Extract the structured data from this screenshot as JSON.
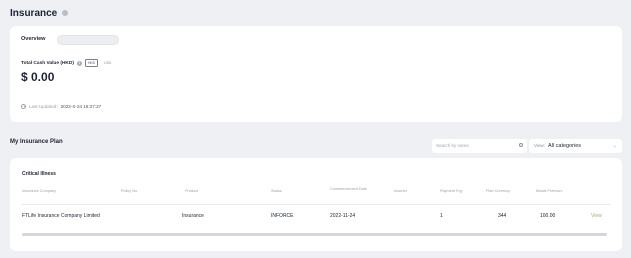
{
  "page": {
    "title": "Insurance"
  },
  "overview": {
    "title": "Overview",
    "total_cash_label": "Total Cash Value (HKD)",
    "currencies": [
      {
        "label": "HKD",
        "active": true
      },
      {
        "label": "USD",
        "active": false
      }
    ],
    "total_cash_value": "$ 0.00",
    "last_updated_label": "Last Updated:",
    "last_updated_value": "2022-X-24 18:27:27"
  },
  "plans": {
    "title": "My Insurance Plan",
    "search_placeholder": "Search by name",
    "view_label": "View:",
    "view_value": "All categories",
    "section": "Critical Illness",
    "columns": [
      "Insurance Company",
      "Policy No.",
      "Product",
      "Status",
      "Commencement Date",
      "Insured",
      "Payment Fqy",
      "Plan Currency",
      "Modal Premium"
    ],
    "rows": [
      {
        "company": "FTLife Insurance Company Limited",
        "policy_no": "",
        "product": "Insurance",
        "status": "INFORCE",
        "commencement_date": "2022-11-24",
        "insured": "",
        "payment_freq": "1",
        "plan_currency": "344",
        "modal_premium": "100.00",
        "action": "View"
      }
    ]
  },
  "colors": {
    "background": "#eef0f3",
    "card": "#ffffff",
    "text": "#1c2433",
    "muted": "#9aa1ab",
    "link": "#9db27a"
  }
}
